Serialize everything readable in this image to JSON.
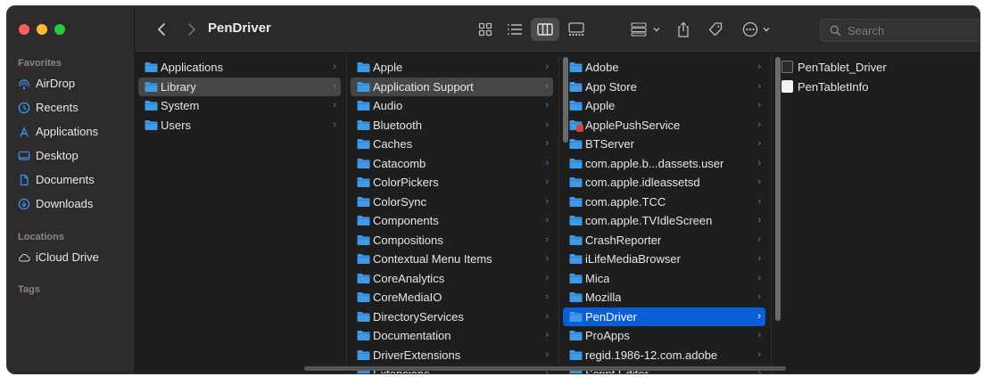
{
  "window": {
    "title": "PenDriver"
  },
  "search": {
    "placeholder": "Search"
  },
  "sidebar": {
    "favorites_heading": "Favorites",
    "favorites": [
      {
        "label": "AirDrop",
        "icon": "airdrop-icon"
      },
      {
        "label": "Recents",
        "icon": "clock-icon"
      },
      {
        "label": "Applications",
        "icon": "applications-icon"
      },
      {
        "label": "Desktop",
        "icon": "desktop-icon"
      },
      {
        "label": "Documents",
        "icon": "document-icon"
      },
      {
        "label": "Downloads",
        "icon": "download-icon"
      }
    ],
    "locations_heading": "Locations",
    "locations": [
      {
        "label": "iCloud Drive",
        "icon": "cloud-icon"
      }
    ],
    "tags_heading": "Tags"
  },
  "columns": {
    "col1": [
      "Applications",
      "Library",
      "System",
      "Users"
    ],
    "col2": [
      "Apple",
      "Application Support",
      "Audio",
      "Bluetooth",
      "Caches",
      "Catacomb",
      "ColorPickers",
      "ColorSync",
      "Components",
      "Compositions",
      "Contextual Menu Items",
      "CoreAnalytics",
      "CoreMediaIO",
      "DirectoryServices",
      "Documentation",
      "DriverExtensions",
      "Extensions"
    ],
    "col3": [
      "Adobe",
      "App Store",
      "Apple",
      "ApplePushService",
      "BTServer",
      "com.apple.b...dassets.user",
      "com.apple.idleassetsd",
      "com.apple.TCC",
      "com.apple.TVIdleScreen",
      "CrashReporter",
      "iLifeMediaBrowser",
      "Mica",
      "Mozilla",
      "PenDriver",
      "ProApps",
      "regid.1986-12.com.adobe",
      "Script Editor"
    ],
    "col4": [
      "PenTablet_Driver",
      "PenTabletInfo"
    ]
  },
  "colors": {
    "selection_blue": "#0a5fd6",
    "folder_blue": "#3f9ae8",
    "accent": "#3a8ee6"
  }
}
